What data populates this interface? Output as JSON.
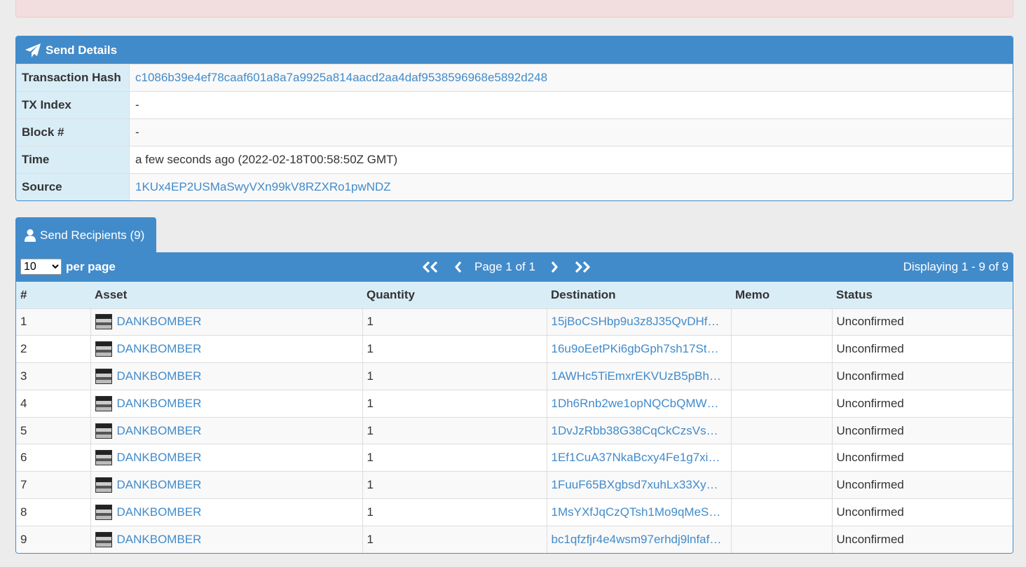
{
  "send_details": {
    "title": "Send Details",
    "rows": [
      {
        "label": "Transaction Hash",
        "value": "c1086b39e4ef78caaf601a8a7a9925a814aacd2aa4daf9538596968e5892d248"
      },
      {
        "label": "TX Index",
        "value": "-"
      },
      {
        "label": "Block #",
        "value": "-"
      },
      {
        "label": "Time",
        "value": "a few seconds ago (2022-02-18T00:58:50Z GMT)"
      },
      {
        "label": "Source",
        "value": "1KUx4EP2USMaSwyVXn99kV8RZXRo1pwNDZ"
      }
    ]
  },
  "recipients_tab": {
    "label": "Send Recipients (9)"
  },
  "toolbar": {
    "per_page_value": "10",
    "per_page_label": "per page",
    "page_label": "Page 1 of 1",
    "displaying": "Displaying 1 - 9 of 9"
  },
  "table": {
    "headers": [
      "#",
      "Asset",
      "Quantity",
      "Destination",
      "Memo",
      "Status"
    ],
    "rows": [
      {
        "n": "1",
        "asset": "DANKBOMBER",
        "qty": "1",
        "dest": "15jBoCSHbp9u3z8J35QvDHf…",
        "memo": "",
        "status": "Unconfirmed"
      },
      {
        "n": "2",
        "asset": "DANKBOMBER",
        "qty": "1",
        "dest": "16u9oEetPKi6gbGph7sh17St…",
        "memo": "",
        "status": "Unconfirmed"
      },
      {
        "n": "3",
        "asset": "DANKBOMBER",
        "qty": "1",
        "dest": "1AWHc5TiEmxrEKVUzB5pBh…",
        "memo": "",
        "status": "Unconfirmed"
      },
      {
        "n": "4",
        "asset": "DANKBOMBER",
        "qty": "1",
        "dest": "1Dh6Rnb2we1opNQCbQMW…",
        "memo": "",
        "status": "Unconfirmed"
      },
      {
        "n": "5",
        "asset": "DANKBOMBER",
        "qty": "1",
        "dest": "1DvJzRbb38G38CqCkCzsVs…",
        "memo": "",
        "status": "Unconfirmed"
      },
      {
        "n": "6",
        "asset": "DANKBOMBER",
        "qty": "1",
        "dest": "1Ef1CuA37NkaBcxy4Fe1g7xi…",
        "memo": "",
        "status": "Unconfirmed"
      },
      {
        "n": "7",
        "asset": "DANKBOMBER",
        "qty": "1",
        "dest": "1FuuF65BXgbsd7xuhLx33Xy…",
        "memo": "",
        "status": "Unconfirmed"
      },
      {
        "n": "8",
        "asset": "DANKBOMBER",
        "qty": "1",
        "dest": "1MsYXfJqCzQTsh1Mo9qMeS…",
        "memo": "",
        "status": "Unconfirmed"
      },
      {
        "n": "9",
        "asset": "DANKBOMBER",
        "qty": "1",
        "dest": "bc1qfzfjr4e4wsm97erhdj9lnfaf…",
        "memo": "",
        "status": "Unconfirmed"
      }
    ]
  },
  "icons": {
    "send": "paper-plane-icon",
    "recipients": "user-icon",
    "first": "double-chevron-left-icon",
    "prev": "chevron-left-icon",
    "next": "chevron-right-icon",
    "last": "double-chevron-right-icon"
  },
  "colors": {
    "primary": "#428bca",
    "header_bg": "#d9edf7",
    "alert_bg": "#f2dede"
  }
}
